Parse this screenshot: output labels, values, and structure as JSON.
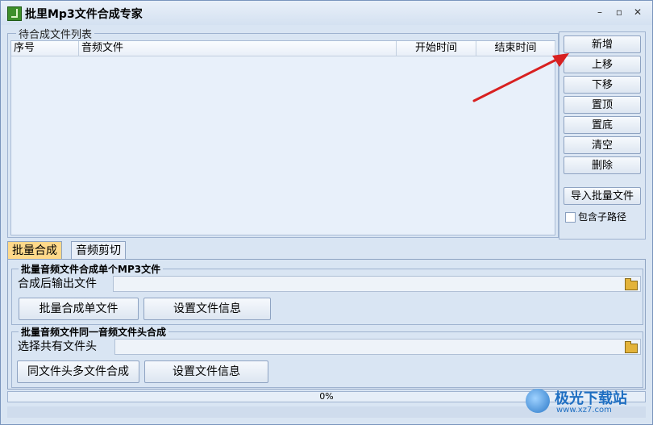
{
  "window": {
    "title": "批里Mp3文件合成专家",
    "controls": {
      "minimize": "–",
      "maximize": "▫",
      "close": "✕"
    }
  },
  "file_list": {
    "group_title": "待合成文件列表",
    "columns": [
      "序号",
      "音频文件",
      "开始时间",
      "结束时间"
    ],
    "rows": []
  },
  "side_buttons": {
    "add": "新增",
    "move_up": "上移",
    "move_down": "下移",
    "to_top": "置顶",
    "to_bottom": "置底",
    "clear": "清空",
    "delete": "删除",
    "import": "导入批量文件",
    "include_subpath": "包含子路径"
  },
  "tabs": [
    {
      "label": "批量合成",
      "active": true
    },
    {
      "label": "音频剪切",
      "active": false
    }
  ],
  "merge_single": {
    "title": "批量音频文件合成单个MP3文件",
    "output_label": "合成后输出文件",
    "output_value": "",
    "merge_button": "批量合成单文件",
    "info_button": "设置文件信息"
  },
  "merge_header": {
    "title": "批量音频文件同一音频文件头合成",
    "header_label": "选择共有文件头",
    "header_value": "",
    "merge_button": "同文件头多文件合成",
    "info_button": "设置文件信息"
  },
  "progress": {
    "value": 0,
    "text": "0%"
  },
  "watermark": {
    "text": "极光下载站",
    "url": "www.xz7.com"
  },
  "colors": {
    "accent_tab": "#ffd98a",
    "annotation_arrow": "#d82020",
    "window_bg": "#d9e5f3"
  }
}
